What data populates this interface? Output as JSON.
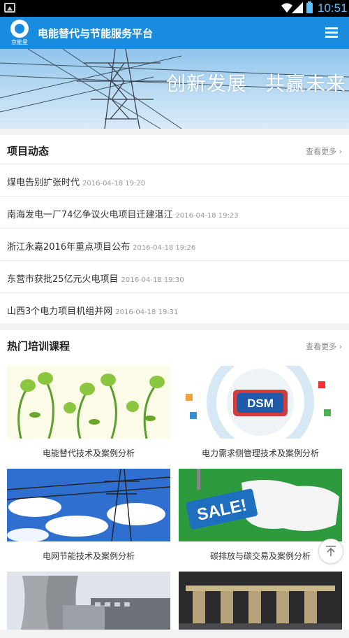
{
  "status_bar": {
    "time": "10:51"
  },
  "app_bar": {
    "logo_text": "京能星",
    "title": "电能替代与节能服务平台"
  },
  "banner": {
    "slogan_1": "创新发展",
    "slogan_2": "共赢未来"
  },
  "news_section": {
    "title": "项目动态",
    "more": "查看更多 ›",
    "items": [
      {
        "title": "煤电告别扩张时代",
        "time": "2016-04-18 19:20"
      },
      {
        "title": "南海发电一厂74亿争议火电项目迁建湛江",
        "time": "2016-04-18 19:23"
      },
      {
        "title": "浙江永嘉2016年重点项目公布",
        "time": "2016-04-18 19:26"
      },
      {
        "title": "东营市获批25亿元火电项目",
        "time": "2016-04-18 19:30"
      },
      {
        "title": "山西3个电力项目机组并网",
        "time": "2016-04-18 19:31"
      }
    ]
  },
  "course_section": {
    "title": "热门培训课程",
    "more": "查看更多 ›",
    "courses": [
      {
        "title": "电能替代技术及案例分析",
        "image": "green-plug-plants"
      },
      {
        "title": "电力需求侧管理技术及案例分析",
        "image": "dsm-diagram",
        "image_text": "DSM"
      },
      {
        "title": "电网节能技术及案例分析",
        "image": "transmission-tower-sky"
      },
      {
        "title": "碳排放与碳交易及案例分析",
        "image": "sale-sign-map",
        "image_text": "SALE!"
      },
      {
        "title": "",
        "image": "cooling-towers"
      },
      {
        "title": "",
        "image": "industrial-equipment"
      }
    ]
  },
  "colors": {
    "primary": "#1a8ce0",
    "status_accent": "#5cc0ff"
  }
}
